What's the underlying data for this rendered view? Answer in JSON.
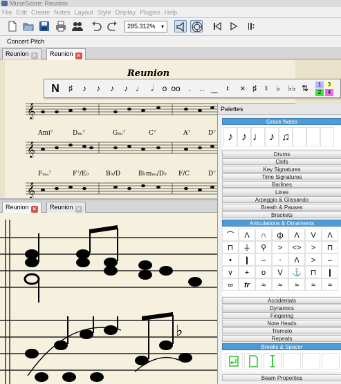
{
  "window": {
    "title": "MuseScore: Reunion"
  },
  "menu": [
    "File",
    "Edit",
    "Create",
    "Notes",
    "Layout",
    "Style",
    "Display",
    "Plugins",
    "Help"
  ],
  "toolbar": {
    "zoom": "285.312%"
  },
  "concert_pitch": "Concert Pitch",
  "tabs_top": [
    {
      "label": "Reunion"
    },
    {
      "label": "Reunion"
    }
  ],
  "tabs_bottom": [
    {
      "label": "Reunion"
    },
    {
      "label": "Reunion"
    }
  ],
  "score": {
    "title": "Reunion",
    "chords_row1": [
      "Ami⁷",
      "Dₘᵢ⁷",
      "Gₘᵢ⁷",
      "C⁷",
      "A⁷",
      "D⁷"
    ],
    "chords_row2": [
      "Fₘₐ⁷",
      "F⁷/E♭",
      "B♭/D",
      "B♭mₘᵢ/D♭",
      "F/C",
      "D⁷"
    ]
  },
  "note_toolbar": {
    "voices": [
      "1",
      "2",
      "3",
      "4"
    ]
  },
  "palettes": {
    "header": "Palettes",
    "sections": [
      {
        "label": "Grace Notes",
        "open": true
      },
      {
        "label": "Drums"
      },
      {
        "label": "Clefs"
      },
      {
        "label": "Key Signatures"
      },
      {
        "label": "Time Signatures"
      },
      {
        "label": "Barlines"
      },
      {
        "label": "Lines"
      },
      {
        "label": "Arpeggio & Glissando"
      },
      {
        "label": "Breath & Pauses"
      },
      {
        "label": "Brackets"
      },
      {
        "label": "Articulations & Ornaments",
        "open": true
      },
      {
        "label": "Accidentals"
      },
      {
        "label": "Dynamics"
      },
      {
        "label": "Fingering"
      },
      {
        "label": "Note Heads"
      },
      {
        "label": "Tremolo"
      },
      {
        "label": "Repeats"
      },
      {
        "label": "Breaks & Spacer",
        "open": true
      },
      {
        "label": "Beam Properties"
      }
    ]
  },
  "colors": {
    "accent": "#4e9bd5",
    "paper": "#f4efdc",
    "close_tab": "#d9534f"
  }
}
